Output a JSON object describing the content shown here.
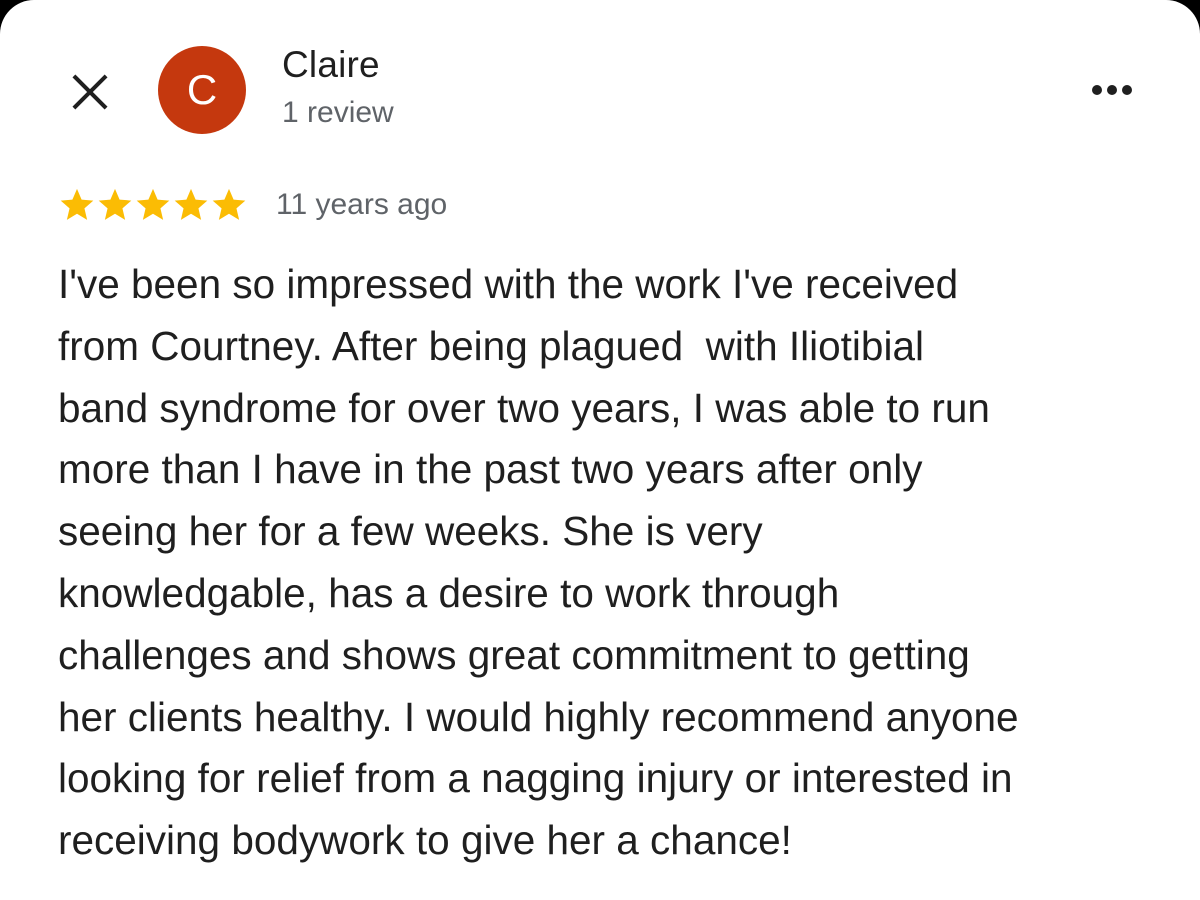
{
  "header": {
    "close_icon": "close-icon",
    "more_icon": "more-horizontal-icon"
  },
  "author": {
    "avatar_letter": "C",
    "avatar_color": "#c5380e",
    "name": "Claire",
    "meta": "1 review"
  },
  "review": {
    "rating": 5,
    "max_rating": 5,
    "star_color": "#fbbc04",
    "date": "11 years ago",
    "text": "I've been so impressed with the work I've received\nfrom Courtney. After being plagued  with Iliotibial\nband syndrome for over two years, I was able to run\nmore than I have in the past two years after only\nseeing her for a few weeks. She is very\nknowledgable, has a desire to work through\nchallenges and shows great commitment to getting\nher clients healthy. I would highly recommend anyone\nlooking for relief from a nagging injury or interested in\nreceiving bodywork to give her a chance!"
  }
}
